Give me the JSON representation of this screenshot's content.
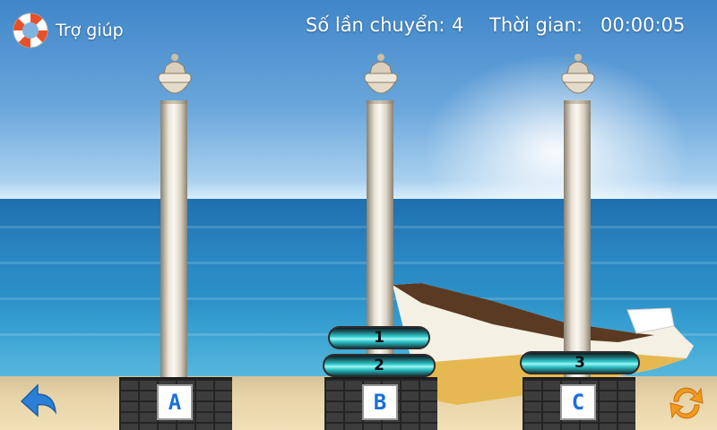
{
  "hud": {
    "help_label": "Trợ giúp",
    "moves_label": "Số lần chuyển:",
    "moves_value": "4",
    "time_label": "Thời gian:",
    "time_value": "00:00:05"
  },
  "pegs": [
    {
      "label": "A"
    },
    {
      "label": "B"
    },
    {
      "label": "C"
    }
  ],
  "disks": [
    {
      "label": "1",
      "peg": "B"
    },
    {
      "label": "2",
      "peg": "B"
    },
    {
      "label": "3",
      "peg": "C"
    }
  ],
  "icons": {
    "help": "lifebuoy-icon",
    "back": "back-arrow-icon",
    "restart": "restart-icon"
  },
  "colors": {
    "disk": "#2fd1d4",
    "peg_label": "#1a6fd8",
    "help_ring": "#e8502a",
    "restart": "#f39a1e",
    "back": "#2a7fd6"
  }
}
